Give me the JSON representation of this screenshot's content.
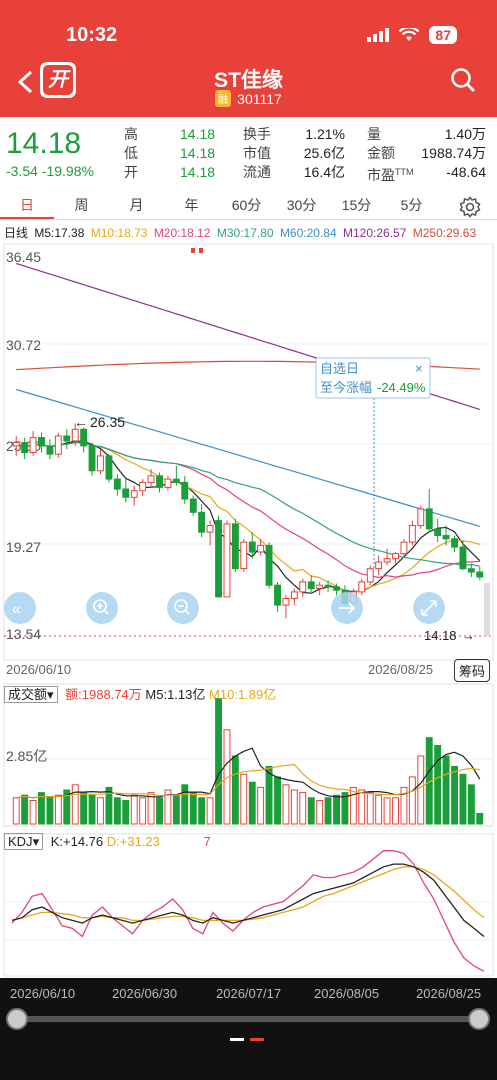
{
  "status": {
    "time": "10:32",
    "battery": "87"
  },
  "header": {
    "open_label": "开",
    "name": "ST佳缘",
    "rong": "融",
    "code": "301117"
  },
  "quote": {
    "price": "14.18",
    "change": "-3.54",
    "change_pct": "-19.98%",
    "col1": [
      {
        "label": "高",
        "value": "14.18"
      },
      {
        "label": "低",
        "value": "14.18"
      },
      {
        "label": "开",
        "value": "14.18"
      }
    ],
    "col2": [
      {
        "label": "换手",
        "value": "1.21%"
      },
      {
        "label": "市值",
        "value": "25.6亿"
      },
      {
        "label": "流通",
        "value": "16.4亿"
      }
    ],
    "col3": [
      {
        "label": "量",
        "value": "1.40万"
      },
      {
        "label": "金额",
        "value": "1988.74万"
      },
      {
        "label": "市盈",
        "tm": "TTM",
        "value": "-48.64"
      }
    ]
  },
  "tabs": [
    "日",
    "周",
    "月",
    "年",
    "60分",
    "30分",
    "15分",
    "5分"
  ],
  "ma": {
    "label": "日线",
    "items": [
      {
        "text": "M5:17.38",
        "color": "#222222"
      },
      {
        "text": "M10:18.73",
        "color": "#e6a817"
      },
      {
        "text": "M20:18.12",
        "color": "#e0447a"
      },
      {
        "text": "M30:17.80",
        "color": "#2fa37a"
      },
      {
        "text": "M60:20.84",
        "color": "#3d8fc9"
      },
      {
        "text": "M120:26.57",
        "color": "#8e2f8f"
      },
      {
        "text": "M250:29.63",
        "color": "#d94b3a"
      }
    ]
  },
  "kline": {
    "price_labels": [
      "36.45",
      "30.72",
      "25.00",
      "19.27",
      "13.54"
    ],
    "high_mark": "26.35",
    "last_mark": "14.18",
    "tooltip_title": "自选日",
    "tooltip_label": "至今涨幅",
    "tooltip_value": "-24.49%",
    "start_date": "2026/06/10",
    "end_date": "2026/08/25",
    "chouma": "筹码"
  },
  "volume": {
    "selector": "成交额",
    "amount": "额:1988.74万",
    "m5": "M5:1.13亿",
    "m10": "M10:1.89亿",
    "level": "2.85亿"
  },
  "kdj": {
    "selector": "KDJ",
    "k": "K:+14.76",
    "d": "D:+31.23",
    "j": "7"
  },
  "timeline": [
    "2026/06/10",
    "2026/06/30",
    "2026/07/17",
    "2026/08/05",
    "2026/08/25"
  ],
  "chart_data": {
    "type": "candlestick",
    "price_axis": [
      13.54,
      36.45
    ],
    "candles": [
      [
        25.0,
        25.6,
        24.4,
        25.2
      ],
      [
        25.2,
        25.5,
        24.2,
        24.6
      ],
      [
        24.6,
        25.9,
        24.4,
        25.5
      ],
      [
        25.5,
        25.8,
        24.6,
        25.0
      ],
      [
        25.0,
        25.4,
        24.2,
        24.5
      ],
      [
        24.5,
        25.8,
        24.3,
        25.6
      ],
      [
        25.6,
        26.0,
        24.8,
        25.3
      ],
      [
        25.3,
        26.35,
        25.0,
        26.0
      ],
      [
        26.0,
        26.1,
        24.6,
        25.0
      ],
      [
        25.0,
        25.2,
        23.2,
        23.5
      ],
      [
        23.5,
        24.8,
        23.3,
        24.4
      ],
      [
        24.4,
        24.5,
        22.8,
        23.0
      ],
      [
        23.0,
        23.3,
        22.0,
        22.4
      ],
      [
        22.4,
        23.0,
        21.6,
        21.9
      ],
      [
        21.9,
        22.6,
        21.4,
        22.3
      ],
      [
        22.3,
        23.0,
        22.0,
        22.8
      ],
      [
        22.8,
        23.6,
        22.5,
        23.2
      ],
      [
        23.2,
        23.4,
        22.2,
        22.5
      ],
      [
        22.5,
        23.2,
        22.3,
        23.0
      ],
      [
        23.0,
        23.8,
        22.6,
        22.8
      ],
      [
        22.8,
        23.2,
        21.5,
        21.8
      ],
      [
        21.8,
        22.0,
        20.8,
        21.0
      ],
      [
        21.0,
        21.5,
        19.5,
        19.8
      ],
      [
        19.8,
        20.5,
        19.0,
        20.2
      ],
      [
        20.5,
        20.8,
        15.9,
        15.9
      ],
      [
        15.9,
        20.5,
        15.9,
        20.3
      ],
      [
        20.3,
        20.6,
        17.4,
        17.6
      ],
      [
        17.6,
        19.4,
        17.4,
        19.2
      ],
      [
        19.2,
        19.8,
        18.2,
        18.6
      ],
      [
        18.6,
        19.4,
        18.4,
        19.0
      ],
      [
        19.0,
        19.2,
        16.4,
        16.6
      ],
      [
        16.6,
        16.8,
        15.0,
        15.4
      ],
      [
        15.4,
        16.0,
        14.6,
        15.8
      ],
      [
        15.8,
        16.4,
        15.4,
        16.2
      ],
      [
        16.2,
        17.0,
        15.9,
        16.8
      ],
      [
        16.8,
        17.2,
        16.2,
        16.4
      ],
      [
        16.4,
        16.8,
        16.0,
        16.6
      ],
      [
        16.6,
        16.9,
        16.2,
        16.5
      ],
      [
        16.5,
        16.7,
        16.0,
        16.3
      ],
      [
        16.3,
        16.6,
        15.2,
        15.5
      ],
      [
        15.5,
        16.4,
        15.3,
        16.2
      ],
      [
        16.2,
        17.0,
        16.0,
        16.8
      ],
      [
        16.8,
        17.8,
        16.6,
        17.6
      ],
      [
        17.6,
        18.4,
        17.2,
        18.0
      ],
      [
        18.0,
        18.8,
        17.8,
        18.2
      ],
      [
        18.2,
        18.6,
        17.9,
        18.5
      ],
      [
        18.5,
        19.4,
        18.3,
        19.2
      ],
      [
        19.2,
        20.5,
        19.0,
        20.2
      ],
      [
        20.2,
        21.4,
        20.0,
        21.2
      ],
      [
        21.2,
        22.4,
        19.8,
        20.0
      ],
      [
        20.0,
        20.6,
        19.2,
        19.6
      ],
      [
        19.6,
        20.2,
        19.0,
        19.4
      ],
      [
        19.4,
        19.6,
        18.6,
        18.9
      ],
      [
        18.9,
        19.3,
        17.5,
        17.6
      ],
      [
        17.6,
        17.9,
        17.1,
        17.4
      ],
      [
        17.4,
        17.7,
        16.9,
        17.1
      ]
    ],
    "volume_axis_max": 4.0,
    "volume": [
      1.0,
      1.1,
      0.9,
      1.2,
      1.0,
      1.1,
      1.3,
      1.5,
      1.2,
      1.1,
      1.0,
      1.4,
      1.0,
      0.9,
      1.1,
      1.0,
      1.2,
      1.0,
      1.3,
      1.1,
      1.5,
      1.2,
      1.0,
      1.0,
      4.8,
      3.6,
      2.6,
      1.9,
      1.6,
      1.4,
      2.2,
      1.8,
      1.5,
      1.3,
      1.2,
      1.0,
      0.9,
      1.0,
      1.1,
      1.2,
      1.4,
      1.3,
      1.2,
      1.1,
      1.0,
      1.0,
      1.4,
      1.8,
      2.6,
      3.3,
      3.0,
      2.6,
      2.2,
      1.9,
      1.5,
      0.4
    ],
    "kdj": {
      "k": [
        40,
        42,
        48,
        50,
        46,
        42,
        40,
        38,
        42,
        44,
        42,
        40,
        38,
        40,
        42,
        44,
        46,
        44,
        40,
        38,
        42,
        40,
        38,
        40,
        42,
        44,
        46,
        48,
        52,
        56,
        60,
        62,
        64,
        66,
        68,
        72,
        76,
        80,
        82,
        82,
        80,
        76,
        70,
        60,
        50,
        40,
        34,
        28
      ],
      "d": [
        40,
        42,
        44,
        46,
        46,
        45,
        44,
        42,
        42,
        43,
        42,
        42,
        40,
        40,
        41,
        42,
        43,
        43,
        42,
        40,
        40,
        40,
        40,
        40,
        41,
        42,
        44,
        46,
        48,
        50,
        54,
        58,
        60,
        63,
        66,
        69,
        72,
        75,
        78,
        80,
        80,
        78,
        74,
        68,
        62,
        55,
        48,
        42
      ],
      "j": [
        38,
        46,
        58,
        60,
        48,
        36,
        34,
        28,
        44,
        50,
        42,
        36,
        30,
        40,
        46,
        50,
        56,
        48,
        34,
        30,
        46,
        38,
        32,
        40,
        46,
        50,
        52,
        54,
        60,
        66,
        74,
        72,
        72,
        74,
        76,
        80,
        86,
        92,
        92,
        90,
        82,
        68,
        56,
        40,
        24,
        12,
        6,
        2
      ]
    }
  }
}
